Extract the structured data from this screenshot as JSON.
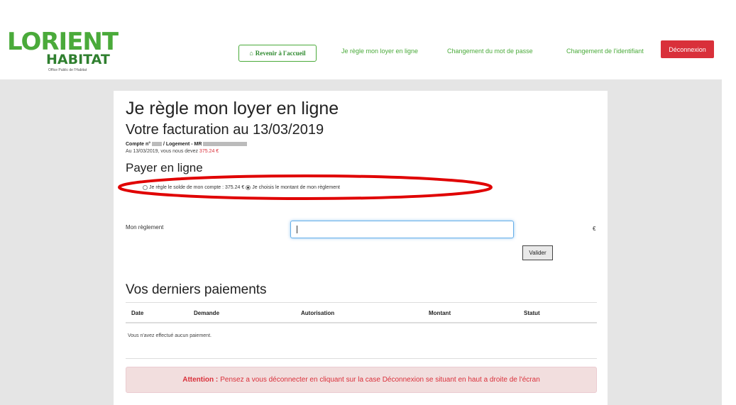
{
  "header": {
    "logo_main": "LORIENT",
    "logo_sub1": "HABITAT",
    "logo_sub2": "Office Public de l'Habitat",
    "home_button": "Revenir à l'accueil",
    "nav": [
      "Je règle mon loyer en ligne",
      "Changement du mot de passe",
      "Changement de l'identifiant"
    ],
    "logout_button": "Déconnexion"
  },
  "main": {
    "title": "Je règle mon loyer en ligne",
    "billing_title": "Votre facturation au 13/03/2019",
    "account_prefix": "Compte n° ",
    "account_mid": " / Logement - MR ",
    "owe_text": "Au 13/03/2019, vous nous devez ",
    "owe_amount": "375.24 €",
    "pay_title": "Payer en ligne",
    "radio_option1": "Je règle le solde de mon compte : 375.24 €",
    "radio_option2": "Je choisis le montant de mon règlement",
    "payment_label": "Mon règlement",
    "payment_value": "",
    "currency": "€",
    "submit_button": "Valider",
    "history_title": "Vos derniers paiements",
    "table_headers": [
      "Date",
      "Demande",
      "Autorisation",
      "Montant",
      "Statut"
    ],
    "empty_message": "Vous n'avez effectué aucun paiement.",
    "alert_strong": "Attention :",
    "alert_text": "Pensez a vous déconnecter en cliquant sur la case Déconnexion se situant en haut a droite de l'écran"
  },
  "colors": {
    "brand_green": "#4aaa3a",
    "logout_red": "#d9303a",
    "annotation_red": "#e00000"
  },
  "icons": {
    "home": "home-icon"
  }
}
